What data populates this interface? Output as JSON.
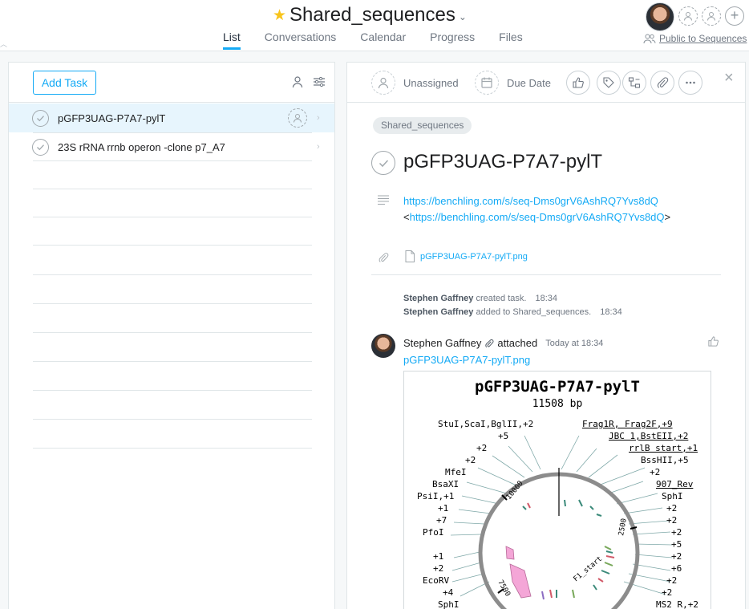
{
  "project": {
    "title": "Shared_sequences"
  },
  "nav": {
    "tabs": [
      "List",
      "Conversations",
      "Calendar",
      "Progress",
      "Files"
    ],
    "active": "List"
  },
  "header": {
    "public_label": "Public to Sequences"
  },
  "left": {
    "add_task": "Add Task",
    "tasks": [
      {
        "name": "pGFP3UAG-P7A7-pylT",
        "selected": true
      },
      {
        "name": "23S rRNA rrnb operon -clone p7_A7",
        "selected": false
      }
    ]
  },
  "detail": {
    "assignee": "Unassigned",
    "due_date": "Due Date",
    "project_pill": "Shared_sequences",
    "title": "pGFP3UAG-P7A7-pylT",
    "description_link": "https://benchling.com/s/seq-Dms0grV6AshRQ7Yvs8dQ",
    "description_link_bracket": "https://benchling.com/s/seq-Dms0grV6AshRQ7Yvs8dQ",
    "attachment": "pGFP3UAG-P7A7-pylT.png",
    "stories": [
      {
        "actor": "Stephen Gaffney",
        "action": "created task.",
        "time": "18:34"
      },
      {
        "actor": "Stephen Gaffney",
        "action": "added to Shared_sequences.",
        "time": "18:34"
      }
    ],
    "comment": {
      "author": "Stephen Gaffney",
      "action": "attached",
      "time": "Today at 18:34",
      "file": "pGFP3UAG-P7A7-pylT.png"
    }
  },
  "plasmid": {
    "name": "pGFP3UAG-P7A7-pylT",
    "size": "11508 bp",
    "left_labels": [
      "StuI,ScaI,BglII,+2",
      "+5",
      "+2",
      "+2",
      "MfeI",
      "BsaXI",
      "PsiI,+1",
      "+1",
      "+7",
      "PfoI",
      "+1",
      "+2",
      "EcoRV",
      "+4",
      "SphI"
    ],
    "right_labels": [
      "Frag1R, Frag2F,+9",
      "JBC 1,BstEII,+2",
      "rrlB start,+1",
      "BssHII,+5",
      "+2",
      "907_Rev",
      "SphI",
      "+2",
      "+2",
      "+2",
      "+5",
      "+2",
      "+6",
      "+2",
      "+2",
      "MS2_R,+2"
    ],
    "ticks": [
      "10000",
      "2500",
      "7500"
    ],
    "feature_label": "F1_start"
  },
  "colors": {
    "accent": "#14aaf5",
    "star": "#f8c41b",
    "feature_pink": "#f4a6d7"
  }
}
